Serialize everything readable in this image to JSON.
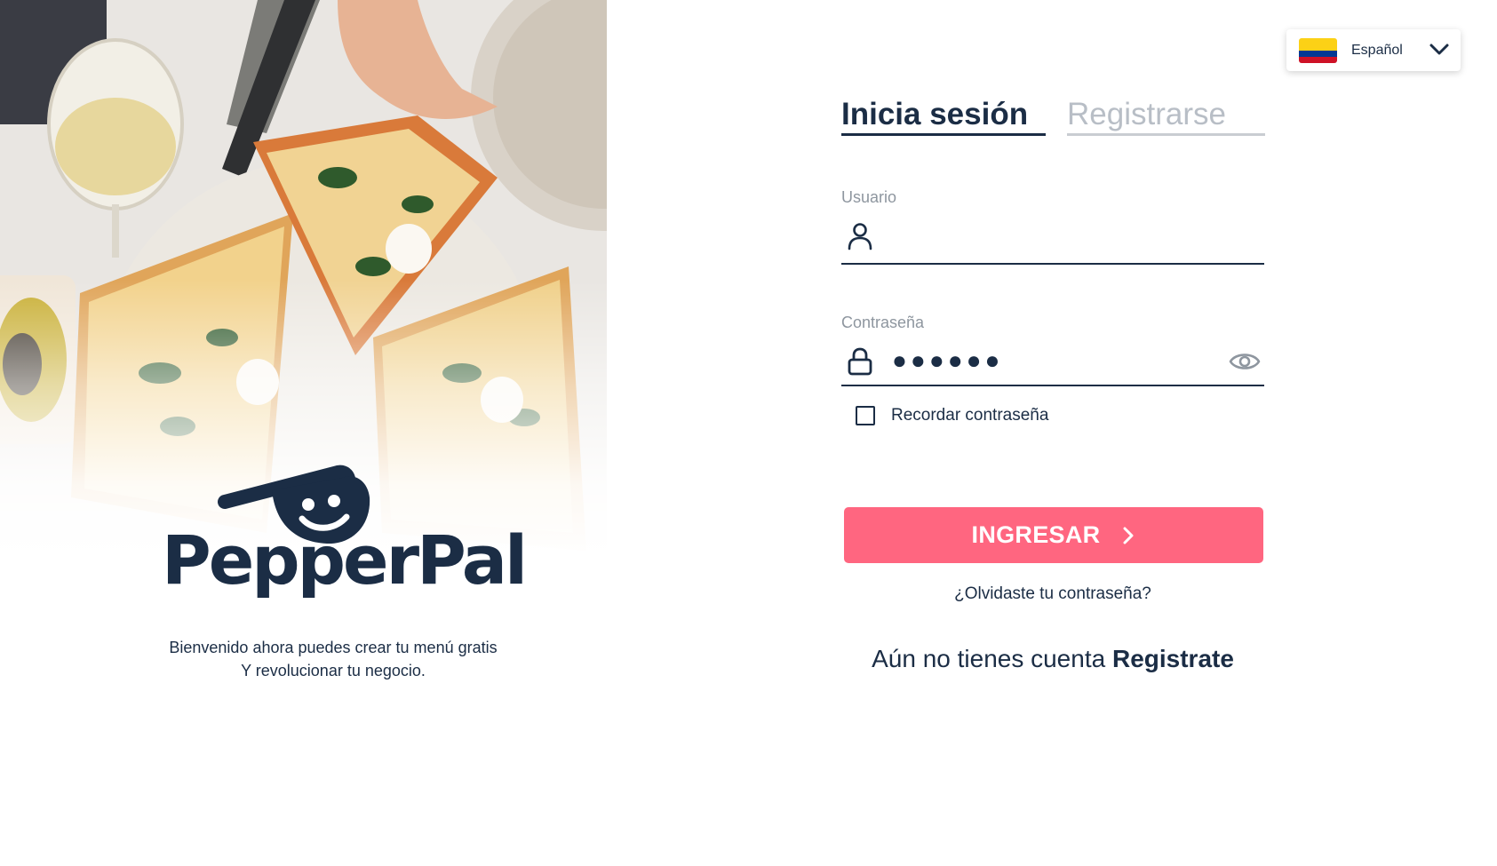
{
  "brand": {
    "name": "PepperPal",
    "tagline_line1": "Bienvenido ahora puedes crear tu menú gratis",
    "tagline_line2": "Y revolucionar tu negocio.",
    "color": "#1b2d45"
  },
  "language": {
    "selected": "Español",
    "flag": "colombia-flag-icon"
  },
  "tabs": [
    {
      "label": "Inicia sesión",
      "active": true
    },
    {
      "label": "Registrarse",
      "active": false
    }
  ],
  "form": {
    "username_label": "Usuario",
    "username_value": "",
    "password_label": "Contraseña",
    "password_masked": "●●●●●●",
    "remember_label": "Recordar contraseña",
    "remember_checked": false,
    "submit_label": "INGRESAR",
    "forgot_label": "¿Olvidaste tu contraseña?",
    "signup_prompt": "Aún no tienes cuenta",
    "signup_link": "Registrate"
  },
  "colors": {
    "accent": "#ff6680",
    "primary": "#1b2d45",
    "muted": "#8e969f",
    "inactive_tab": "#b8bec6"
  }
}
